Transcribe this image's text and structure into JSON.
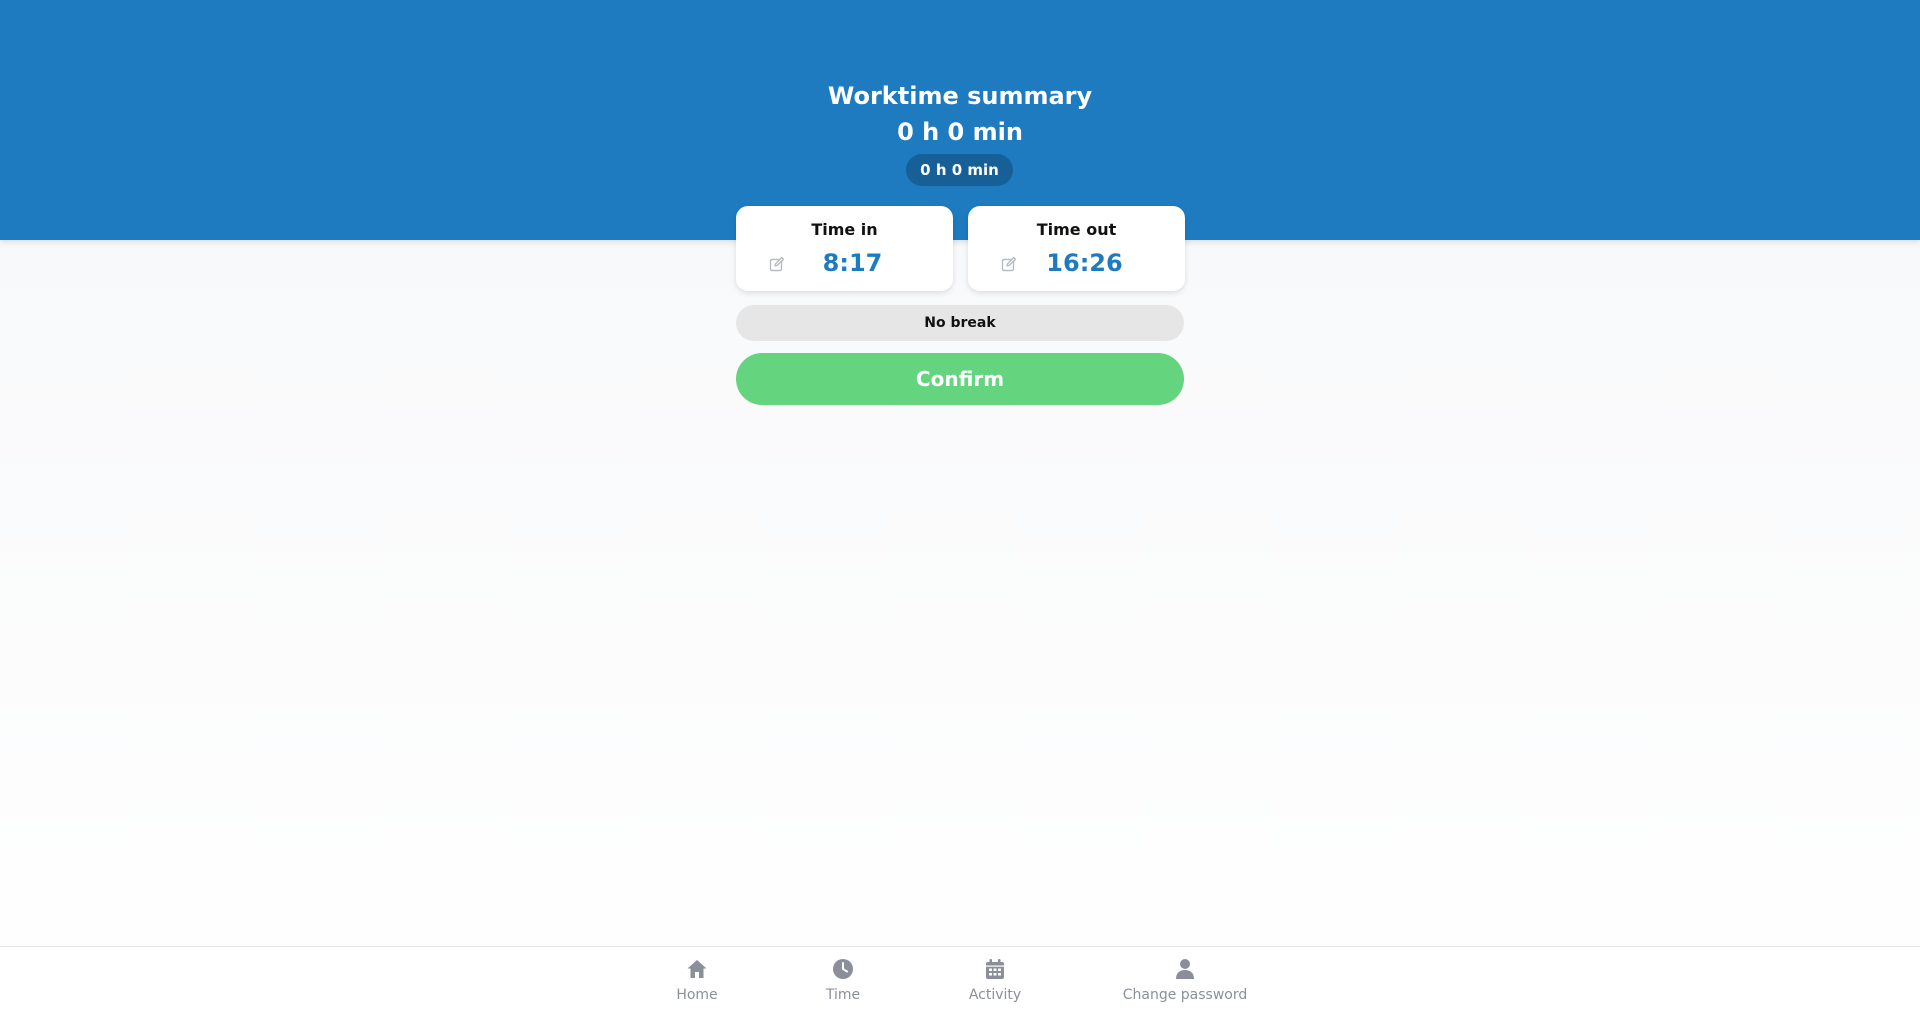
{
  "header": {
    "title": "Worktime summary",
    "total": "0 h 0 min",
    "pill": "0 h 0 min",
    "background_color": "#1e7bc0"
  },
  "time_in": {
    "label": "Time in",
    "value": "8:17",
    "icon": "edit-icon"
  },
  "time_out": {
    "label": "Time out",
    "value": "16:26",
    "icon": "edit-icon"
  },
  "break": {
    "label": "No break"
  },
  "confirm": {
    "label": "Confirm",
    "color": "#65d47f"
  },
  "nav": {
    "items": [
      {
        "label": "Home",
        "icon": "home-icon"
      },
      {
        "label": "Time",
        "icon": "clock-icon"
      },
      {
        "label": "Activity",
        "icon": "calendar-icon"
      },
      {
        "label": "Change password",
        "icon": "user-icon"
      }
    ]
  }
}
